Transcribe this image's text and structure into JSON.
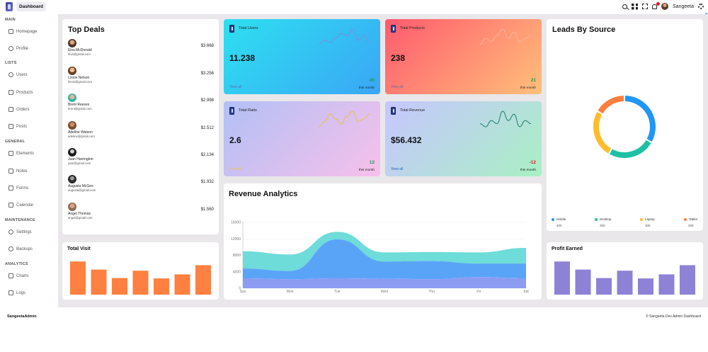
{
  "header": {
    "brand_label": "Dashboard",
    "user_name": "Sangeeta",
    "icons": [
      "search-icon",
      "app-grid-icon",
      "expand-icon",
      "bell-icon",
      "settings-icon"
    ]
  },
  "sidebar": {
    "sections": [
      {
        "title": "MAIN",
        "items": [
          {
            "label": "Homepage",
            "icon": "home-icon"
          },
          {
            "label": "Profile",
            "icon": "user-icon"
          }
        ]
      },
      {
        "title": "LISTS",
        "items": [
          {
            "label": "Users",
            "icon": "users-icon"
          },
          {
            "label": "Products",
            "icon": "cart-icon"
          },
          {
            "label": "Orders",
            "icon": "orders-icon"
          },
          {
            "label": "Posts",
            "icon": "posts-icon"
          }
        ]
      },
      {
        "title": "GENERAL",
        "items": [
          {
            "label": "Elements",
            "icon": "elements-icon"
          },
          {
            "label": "Notes",
            "icon": "notes-icon"
          },
          {
            "label": "Forms",
            "icon": "forms-icon"
          },
          {
            "label": "Calendar",
            "icon": "calendar-icon"
          }
        ]
      },
      {
        "title": "MAINTENANCE",
        "items": [
          {
            "label": "Settings",
            "icon": "gear-icon"
          },
          {
            "label": "Backups",
            "icon": "backup-icon"
          }
        ]
      },
      {
        "title": "ANALYTICS",
        "items": [
          {
            "label": "Charts",
            "icon": "chart-icon"
          },
          {
            "label": "Logs",
            "icon": "logs-icon"
          }
        ]
      }
    ]
  },
  "top_deals": {
    "title": "Top Deals",
    "deals": [
      {
        "name": "Elva McDonald",
        "email": "elva@gmail.com",
        "amount": "$3.668"
      },
      {
        "name": "Linnie Nelson",
        "email": "linnie@gmail.com",
        "amount": "$3.256"
      },
      {
        "name": "Brent Reeves",
        "email": "brent@gmail.com",
        "amount": "$2.998"
      },
      {
        "name": "Adeline Watson",
        "email": "adeline@gmail.com",
        "amount": "$2.512"
      },
      {
        "name": "Juan Harrington",
        "email": "juan@gmail.com",
        "amount": "$2.134"
      },
      {
        "name": "Augusta McGee",
        "email": "augusta@gmail.com",
        "amount": "$1.932"
      },
      {
        "name": "Angel Thomas",
        "email": "angel@gmail.com",
        "amount": "$1.560"
      }
    ]
  },
  "stats": [
    {
      "title": "Total Users",
      "value": "11.238",
      "link": "View all",
      "percent": "45",
      "percent_color": "#1f9b4a",
      "period": "this month",
      "colors": [
        "#2ee0f0",
        "#3aa6f6"
      ],
      "line_color": "#7b8fd8",
      "trend": [
        3,
        5,
        4,
        6,
        8,
        7,
        10,
        5,
        7,
        4
      ]
    },
    {
      "title": "Total Products",
      "value": "238",
      "link": "View all",
      "percent": "21",
      "percent_color": "#1f9b4a",
      "period": "this month",
      "colors": [
        "#ff5a6e",
        "#ffc07a"
      ],
      "line_color": "#f6b49a",
      "trend": [
        4,
        6,
        5,
        7,
        9,
        6,
        8,
        5,
        6,
        7
      ]
    },
    {
      "title": "Total Ratio",
      "value": "2.6",
      "link": "View all",
      "percent": "12",
      "percent_color": "#1f9b4a",
      "period": "this month",
      "colors": [
        "#b2c0f6",
        "#f7c0ea"
      ],
      "line_color": "#e6c34a",
      "trend": [
        3,
        5,
        8,
        6,
        4,
        7,
        9,
        5,
        6,
        8
      ]
    },
    {
      "title": "Total Revenue",
      "value": "$56.432",
      "link": "View all",
      "percent": "-12",
      "percent_color": "#e0182a",
      "period": "this month",
      "colors": [
        "#c7c6ff",
        "#a9f0c4"
      ],
      "line_color": "#1f7d6a",
      "trend": [
        5,
        4,
        6,
        5,
        9,
        6,
        8,
        4,
        6,
        5
      ]
    }
  ],
  "leads": {
    "title": "Leads By Source",
    "legend": [
      {
        "name": "Mobile",
        "value": "400",
        "color": "#2196f3"
      },
      {
        "name": "Desktop",
        "value": "300",
        "color": "#1fbfa5"
      },
      {
        "name": "Laptop",
        "value": "300",
        "color": "#ffbc2a"
      },
      {
        "name": "Tablet",
        "value": "200",
        "color": "#ff7e3e"
      }
    ]
  },
  "revenue": {
    "title": "Revenue Analytics"
  },
  "total_visit": {
    "title": "Total Visit",
    "bar_color": "#ff8040",
    "values": [
      90,
      68,
      45,
      65,
      44,
      55,
      80
    ]
  },
  "profit": {
    "title": "Profit Earned",
    "bar_color": "#8e82d6",
    "values": [
      90,
      68,
      45,
      65,
      44,
      55,
      80
    ]
  },
  "chart_data": {
    "type": "area",
    "title": "Revenue Analytics",
    "categories": [
      "Sun",
      "Mon",
      "Tue",
      "Wed",
      "Thu",
      "Fri",
      "Sat"
    ],
    "ylim": [
      0,
      16000
    ],
    "yticks": [
      0,
      4000,
      8000,
      12000,
      16000
    ],
    "series": [
      {
        "color": "#8b9cf1",
        "values": [
          2400,
          2200,
          2400,
          2300,
          2200,
          2700,
          2400
        ]
      },
      {
        "color": "#5aa4f8",
        "values": [
          2400,
          2000,
          9500,
          4200,
          4400,
          3300,
          3600
        ]
      },
      {
        "color": "#6edcd9",
        "values": [
          4200,
          4000,
          1800,
          2200,
          2200,
          2700,
          3800
        ]
      }
    ]
  },
  "footer": {
    "brand": "SangeetaAdmin",
    "copyright": "© Sangeeta Dev Admin Dashboard"
  }
}
